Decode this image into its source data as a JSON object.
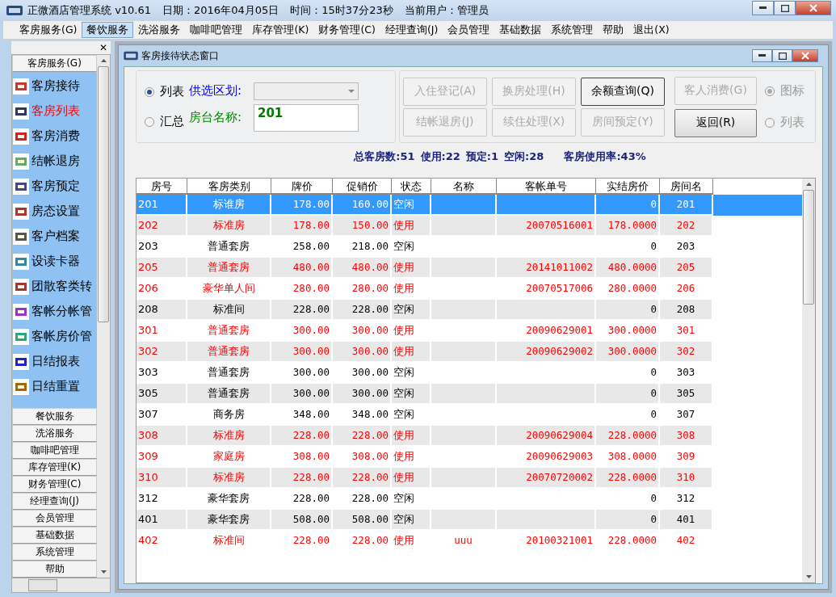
{
  "window": {
    "title": "正微酒店管理系统 v10.61",
    "date_label": "日期：2016年04月05日",
    "time_label": "时间：15时37分23秒",
    "user_label": "当前用户：管理员"
  },
  "menu": [
    {
      "label": "客房服务(G)",
      "selected": false
    },
    {
      "label": "餐饮服务",
      "selected": true
    },
    {
      "label": "洗浴服务",
      "selected": false
    },
    {
      "label": "咖啡吧管理",
      "selected": false
    },
    {
      "label": "库存管理(K)",
      "selected": false
    },
    {
      "label": "财务管理(C)",
      "selected": false
    },
    {
      "label": "经理查询(J)",
      "selected": false
    },
    {
      "label": "会员管理",
      "selected": false
    },
    {
      "label": "基础数据",
      "selected": false
    },
    {
      "label": "系统管理",
      "selected": false
    },
    {
      "label": "帮助",
      "selected": false
    },
    {
      "label": "退出(X)",
      "selected": false
    }
  ],
  "sidebar": {
    "close": "✕",
    "header": "客房服务(G)",
    "items": [
      {
        "label": "客房接待",
        "selected": false
      },
      {
        "label": "客房列表",
        "selected": true
      },
      {
        "label": "客房消费",
        "selected": false
      },
      {
        "label": "结帐退房",
        "selected": false
      },
      {
        "label": "客房预定",
        "selected": false
      },
      {
        "label": "房态设置",
        "selected": false
      },
      {
        "label": "客户档案",
        "selected": false
      },
      {
        "label": "设读卡器",
        "selected": false
      },
      {
        "label": "团散客类转",
        "selected": false
      },
      {
        "label": "客帐分帐管",
        "selected": false
      },
      {
        "label": "客帐房价管",
        "selected": false
      },
      {
        "label": "日结报表",
        "selected": false
      },
      {
        "label": "日结重置",
        "selected": false
      }
    ],
    "sections": [
      "餐饮服务",
      "洗浴服务",
      "咖啡吧管理",
      "库存管理(K)",
      "财务管理(C)",
      "经理查询(J)",
      "会员管理",
      "基础数据",
      "系统管理",
      "帮助"
    ]
  },
  "child_window": {
    "title": "客房接待状态窗口",
    "view_options": [
      {
        "label": "列表",
        "selected": true
      },
      {
        "label": "汇总",
        "selected": false
      }
    ],
    "area_label": "供选区划:",
    "room_label": "房台名称:",
    "room_value": "201",
    "actions": [
      {
        "label": "入住登记(A)",
        "disabled": true,
        "focused": false
      },
      {
        "label": "换房处理(H)",
        "disabled": true,
        "focused": false
      },
      {
        "label": "余额查询(Q)",
        "disabled": false,
        "focused": true
      },
      {
        "label": "结帐退房(J)",
        "disabled": true,
        "focused": false
      },
      {
        "label": "续住处理(X)",
        "disabled": true,
        "focused": false
      },
      {
        "label": "房间预定(Y)",
        "disabled": true,
        "focused": false
      }
    ],
    "side_buttons": [
      {
        "label": "客人消费(G)",
        "disabled": true
      },
      {
        "label": "返回(R)",
        "disabled": false
      }
    ],
    "display_options": [
      {
        "label": "图标",
        "selected": true,
        "disabled": true
      },
      {
        "label": "列表",
        "selected": false,
        "disabled": true
      }
    ],
    "summary": [
      {
        "label": "总客房数:51"
      },
      {
        "label": "使用:22"
      },
      {
        "label": "预定:1"
      },
      {
        "label": "空闲:28"
      },
      {
        "label": "客房使用率:43%"
      }
    ]
  },
  "table": {
    "columns": [
      "房号",
      "客房类别",
      "牌价",
      "促销价",
      "状态",
      "名称",
      "客帐单号",
      "实结房价",
      "房间名"
    ],
    "rows": [
      {
        "cells": [
          "201",
          "标谁房",
          "178.00",
          "160.00",
          "空闲",
          "",
          "",
          "0",
          "201"
        ],
        "occupied": false,
        "selected": true
      },
      {
        "cells": [
          "202",
          "标准房",
          "178.00",
          "150.00",
          "使用",
          "",
          "20070516001",
          "178.0000",
          "202"
        ],
        "occupied": true,
        "selected": false
      },
      {
        "cells": [
          "203",
          "普通套房",
          "258.00",
          "218.00",
          "空闲",
          "",
          "",
          "0",
          "203"
        ],
        "occupied": false,
        "selected": false
      },
      {
        "cells": [
          "205",
          "普通套房",
          "480.00",
          "480.00",
          "使用",
          "",
          "20141011002",
          "480.0000",
          "205"
        ],
        "occupied": true,
        "selected": false
      },
      {
        "cells": [
          "206",
          "豪华单人间",
          "280.00",
          "280.00",
          "使用",
          "",
          "20070517006",
          "280.0000",
          "206"
        ],
        "occupied": true,
        "selected": false
      },
      {
        "cells": [
          "208",
          "标准间",
          "228.00",
          "228.00",
          "空闲",
          "",
          "",
          "0",
          "208"
        ],
        "occupied": false,
        "selected": false
      },
      {
        "cells": [
          "301",
          "普通套房",
          "300.00",
          "300.00",
          "使用",
          "",
          "20090629001",
          "300.0000",
          "301"
        ],
        "occupied": true,
        "selected": false
      },
      {
        "cells": [
          "302",
          "普通套房",
          "300.00",
          "300.00",
          "使用",
          "",
          "20090629002",
          "300.0000",
          "302"
        ],
        "occupied": true,
        "selected": false
      },
      {
        "cells": [
          "303",
          "普通套房",
          "300.00",
          "300.00",
          "空闲",
          "",
          "",
          "0",
          "303"
        ],
        "occupied": false,
        "selected": false
      },
      {
        "cells": [
          "305",
          "普通套房",
          "300.00",
          "300.00",
          "空闲",
          "",
          "",
          "0",
          "305"
        ],
        "occupied": false,
        "selected": false
      },
      {
        "cells": [
          "307",
          "商务房",
          "348.00",
          "348.00",
          "空闲",
          "",
          "",
          "0",
          "307"
        ],
        "occupied": false,
        "selected": false
      },
      {
        "cells": [
          "308",
          "标准房",
          "228.00",
          "228.00",
          "使用",
          "",
          "20090629004",
          "228.0000",
          "308"
        ],
        "occupied": true,
        "selected": false
      },
      {
        "cells": [
          "309",
          "家庭房",
          "308.00",
          "308.00",
          "使用",
          "",
          "20090629003",
          "308.0000",
          "309"
        ],
        "occupied": true,
        "selected": false
      },
      {
        "cells": [
          "310",
          "标准房",
          "228.00",
          "228.00",
          "使用",
          "",
          "20070720002",
          "228.0000",
          "310"
        ],
        "occupied": true,
        "selected": false
      },
      {
        "cells": [
          "312",
          "豪华套房",
          "228.00",
          "228.00",
          "空闲",
          "",
          "",
          "0",
          "312"
        ],
        "occupied": false,
        "selected": false
      },
      {
        "cells": [
          "401",
          "豪华套房",
          "508.00",
          "508.00",
          "空闲",
          "",
          "",
          "0",
          "401"
        ],
        "occupied": false,
        "selected": false
      },
      {
        "cells": [
          "402",
          "标准间",
          "228.00",
          "228.00",
          "使用",
          "uuu",
          "20100321001",
          "228.0000",
          "402"
        ],
        "occupied": true,
        "selected": false
      }
    ]
  }
}
